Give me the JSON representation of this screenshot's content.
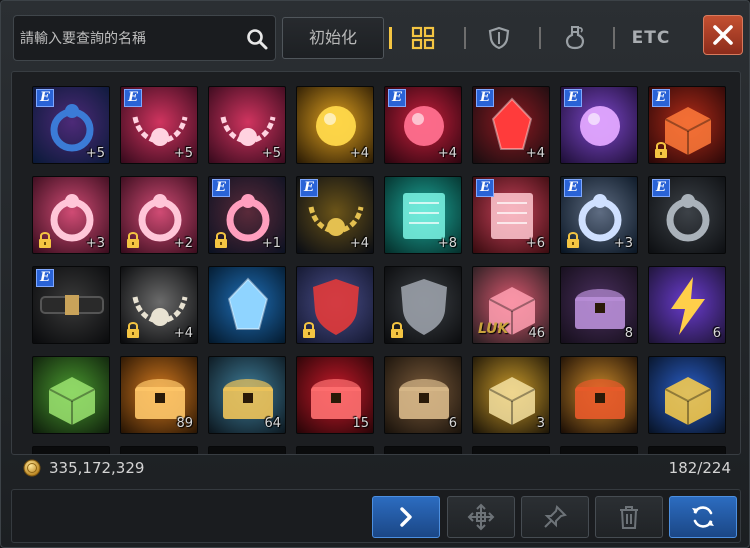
{
  "search": {
    "placeholder": "請輸入要查詢的名稱",
    "icon": "search-icon"
  },
  "toolbar": {
    "reset_label": "初始化",
    "filters": [
      {
        "id": "all",
        "icon": "grid-icon",
        "active": true
      },
      {
        "id": "equipment",
        "icon": "shield-icon",
        "active": false
      },
      {
        "id": "consumable",
        "icon": "potion-icon",
        "active": false
      },
      {
        "id": "etc",
        "label": "ETC",
        "active": false
      }
    ],
    "close_icon": "close-icon"
  },
  "inventory": {
    "columns": 8,
    "slots": [
      {
        "art": "dark-gem-ring",
        "equip_badge": "E",
        "locked": false,
        "count": "+5"
      },
      {
        "art": "pink-chain-bracelet",
        "equip_badge": "E",
        "locked": false,
        "count": "+5"
      },
      {
        "art": "pink-chain-bracelet",
        "equip_badge": "",
        "locked": false,
        "count": "+5"
      },
      {
        "art": "gold-pendant",
        "equip_badge": "",
        "locked": false,
        "count": "+4"
      },
      {
        "art": "ruby-amulet",
        "equip_badge": "E",
        "locked": false,
        "count": "+4"
      },
      {
        "art": "red-gem-emblem",
        "equip_badge": "E",
        "locked": false,
        "count": "+4"
      },
      {
        "art": "purple-orb",
        "equip_badge": "E",
        "locked": false,
        "count": ""
      },
      {
        "art": "red-belt",
        "equip_badge": "E",
        "locked": true,
        "count": ""
      },
      {
        "art": "pink-dragon-ring",
        "equip_badge": "",
        "locked": true,
        "count": "+3"
      },
      {
        "art": "pink-dragon-ring",
        "equip_badge": "",
        "locked": true,
        "count": "+2"
      },
      {
        "art": "pink-ring",
        "equip_badge": "E",
        "locked": true,
        "count": "+1"
      },
      {
        "art": "gem-necklace",
        "equip_badge": "E",
        "locked": false,
        "count": "+4"
      },
      {
        "art": "cyan-rune-tablet",
        "equip_badge": "",
        "locked": false,
        "count": "+8"
      },
      {
        "art": "red-rune-tablet",
        "equip_badge": "E",
        "locked": false,
        "count": "+6"
      },
      {
        "art": "silver-ring",
        "equip_badge": "E",
        "locked": true,
        "count": "+3"
      },
      {
        "art": "silver-bangle",
        "equip_badge": "E",
        "locked": false,
        "count": ""
      },
      {
        "art": "leather-belt",
        "equip_badge": "E",
        "locked": false,
        "count": ""
      },
      {
        "art": "skull-necklace",
        "equip_badge": "",
        "locked": true,
        "count": "+4"
      },
      {
        "art": "blue-crystal",
        "equip_badge": "",
        "locked": false,
        "count": ""
      },
      {
        "art": "upgrade-shield",
        "equip_badge": "",
        "locked": true,
        "count": ""
      },
      {
        "art": "dark-helm",
        "equip_badge": "",
        "locked": true,
        "count": ""
      },
      {
        "art": "luk-box",
        "equip_badge": "",
        "locked": false,
        "count": "46",
        "text_label": "LUK"
      },
      {
        "art": "dark-chest",
        "equip_badge": "",
        "locked": false,
        "count": "8"
      },
      {
        "art": "lightning-scroll",
        "equip_badge": "",
        "locked": false,
        "count": "6"
      },
      {
        "art": "green-box",
        "equip_badge": "",
        "locked": false,
        "count": ""
      },
      {
        "art": "orange-chest",
        "equip_badge": "",
        "locked": false,
        "count": "89"
      },
      {
        "art": "treasure-chest",
        "equip_badge": "",
        "locked": false,
        "count": "64"
      },
      {
        "art": "red-chest",
        "equip_badge": "",
        "locked": false,
        "count": "15"
      },
      {
        "art": "wood-chest",
        "equip_badge": "",
        "locked": false,
        "count": "6"
      },
      {
        "art": "gold-box-scroll",
        "equip_badge": "",
        "locked": false,
        "count": "3"
      },
      {
        "art": "gold-box-medal",
        "equip_badge": "",
        "locked": false,
        "count": ""
      },
      {
        "art": "blue-gift",
        "equip_badge": "",
        "locked": false,
        "count": ""
      }
    ]
  },
  "footer": {
    "gold_icon": "gold-coin-icon",
    "gold_amount": "335,172,329",
    "capacity": "182/224"
  },
  "bottom_buttons": [
    {
      "id": "expand",
      "icon": "chevron-right-icon",
      "accent": true
    },
    {
      "id": "move",
      "icon": "move-arrows-icon",
      "accent": false
    },
    {
      "id": "pin",
      "icon": "pin-icon",
      "accent": false
    },
    {
      "id": "delete",
      "icon": "trash-icon",
      "accent": false
    },
    {
      "id": "sort",
      "icon": "refresh-icon",
      "accent": true
    }
  ],
  "colors": {
    "accent_gold": "#f4c542",
    "close_red": "#b8452b",
    "button_blue": "#2c6cc0",
    "equip_badge_blue": "#2a63d6"
  }
}
